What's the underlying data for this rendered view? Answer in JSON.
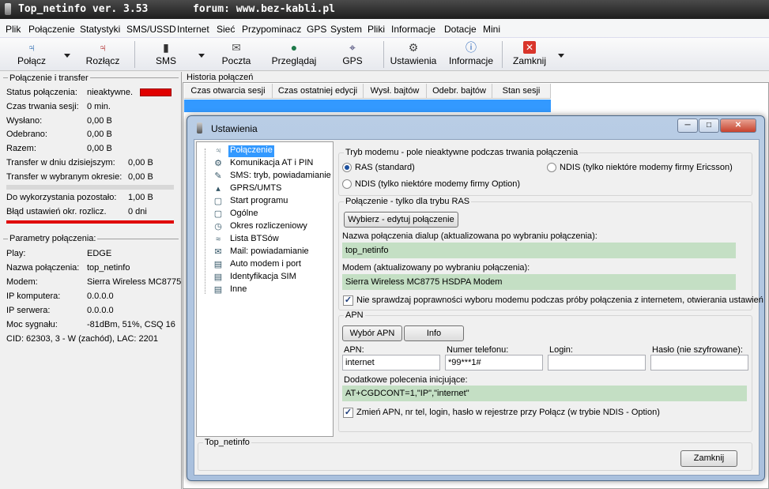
{
  "window": {
    "title": "Top_netinfo ver. 3.53",
    "forum": "forum: www.bez-kabli.pl"
  },
  "menu": [
    "Plik",
    "Połączenie",
    "Statystyki",
    "SMS/USSD",
    "Internet",
    "Sieć",
    "Przypominacz",
    "GPS",
    "System",
    "Pliki",
    "Informacje",
    "Dotacje",
    "Mini"
  ],
  "toolbar": {
    "connect": "Połącz",
    "disconnect": "Rozłącz",
    "sms": "SMS",
    "mail": "Poczta",
    "browse": "Przeglądaj",
    "gps": "GPS",
    "settings": "Ustawienia",
    "info": "Informacje",
    "close": "Zamknij"
  },
  "connection": {
    "group_label": "Połączenie i transfer",
    "status_label": "Status połączenia:",
    "status_value": "nieaktywne.",
    "status_color": "#e00000",
    "duration_label": "Czas trwania sesji:",
    "duration_value": "0 min.",
    "sent_label": "Wysłano:",
    "sent_value": "0,00 B",
    "received_label": "Odebrano:",
    "received_value": "0,00 B",
    "total_label": "Razem:",
    "total_value": "0,00 B",
    "today_label": "Transfer w dniu dzisiejszym:",
    "today_value": "0,00 B",
    "period_label": "Transfer w wybranym okresie:",
    "period_value": "0,00 B",
    "remaining_label": "Do wykorzystania pozostało:",
    "remaining_value": "1,00 B",
    "error_label": "Błąd ustawień okr. rozlicz.",
    "error_value": "0 dni",
    "bar_color": "#e00000"
  },
  "params": {
    "group_label": "Parametry połączenia:",
    "play_label": "Play:",
    "play_value": "EDGE",
    "name_label": "Nazwa połączenia:",
    "name_value": "top_netinfo",
    "modem_label": "Modem:",
    "modem_value": "Sierra Wireless MC8775",
    "ip_comp_label": "IP komputera:",
    "ip_comp_value": "0.0.0.0",
    "ip_server_label": "IP serwera:",
    "ip_server_value": "0.0.0.0",
    "signal_label": "Moc sygnału:",
    "signal_value": "-81dBm, 51%, CSQ 16",
    "cid": "CID: 62303, 3 - W (zachód), LAC: 2201"
  },
  "history": {
    "label": "Historia połączeń",
    "columns": [
      "Czas otwarcia sesji",
      "Czas ostatniej edycji",
      "Wysł. bajtów",
      "Odebr. bajtów",
      "Stan sesji"
    ],
    "selected_color": "#3399ff"
  },
  "dialog": {
    "title": "Ustawienia",
    "tree": [
      {
        "label": "Połączenie",
        "icon": "network-icon",
        "selected": true
      },
      {
        "label": "Komunikacja AT i PIN",
        "icon": "at-icon"
      },
      {
        "label": "SMS: tryb, powiadamianie",
        "icon": "sms-icon"
      },
      {
        "label": "GPRS/UMTS",
        "icon": "gprs-icon"
      },
      {
        "label": "Start programu",
        "icon": "start-icon"
      },
      {
        "label": "Ogólne",
        "icon": "general-icon"
      },
      {
        "label": "Okres rozliczeniowy",
        "icon": "calendar-icon"
      },
      {
        "label": "Lista BTSów",
        "icon": "antenna-icon"
      },
      {
        "label": "Mail: powiadamianie",
        "icon": "mail-icon"
      },
      {
        "label": "Auto modem i port",
        "icon": "modem-icon"
      },
      {
        "label": "Identyfikacja SIM",
        "icon": "sim-icon"
      },
      {
        "label": "Inne",
        "icon": "other-icon"
      }
    ],
    "mode_group": "Tryb modemu - pole nieaktywne podczas trwania połączenia",
    "mode_ras": "RAS (standard)",
    "mode_ndis_ericsson": "NDIS (tylko niektóre modemy firmy Ericsson)",
    "mode_ndis_option": "NDIS (tylko niektóre modemy firmy Option)",
    "conn_group": "Połączenie - tylko dla trybu RAS",
    "choose_button": "Wybierz - edytuj połączenie",
    "dialup_label": "Nazwa połączenia dialup (aktualizowana po wybraniu połączenia):",
    "dialup_value": "top_netinfo",
    "modem_label": "Modem (aktualizowany po wybraniu połączenia):",
    "modem_value": "Sierra Wireless MC8775 HSDPA Modem",
    "check_label": "Nie sprawdzaj poprawności wyboru modemu podczas próby połączenia z internetem, otwierania ustawień",
    "apn_group": "APN",
    "apn_choose_button": "Wybór APN",
    "apn_info_button": "Info",
    "apn_label": "APN:",
    "apn_value": "internet",
    "phone_label": "Numer telefonu:",
    "phone_value": "*99***1#",
    "login_label": "Login:",
    "login_value": "",
    "password_label": "Hasło (nie szyfrowane):",
    "password_value": "",
    "init_label": "Dodatkowe polecenia inicjujące:",
    "init_value": "AT+CGDCONT=1,\"IP\",\"internet\"",
    "apn_check_label": "Zmień APN, nr tel, login, hasło w rejestrze przy Połącz (w trybie NDIS - Option)",
    "footer_group": "Top_netinfo",
    "close_button": "Zamknij",
    "field_color": "#c4dfc4"
  }
}
